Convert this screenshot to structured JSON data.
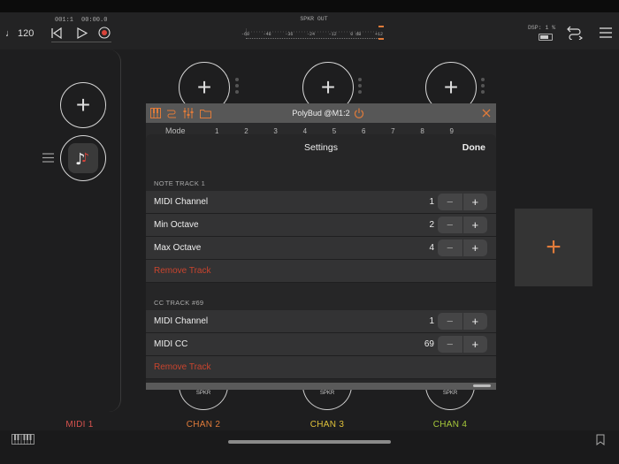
{
  "transport": {
    "bpm": "♩ 120",
    "position": "001:1",
    "time": "00:00.0"
  },
  "meter": {
    "label": "SPKR OUT",
    "ticks": [
      "-60",
      "-48",
      "-36",
      "-24",
      "-12",
      "0 dB",
      "+12"
    ]
  },
  "dsp": {
    "label": "DSP: 1 %"
  },
  "plugin": {
    "title": "PolyBud @M1:2",
    "mode_label": "Mode",
    "mode_numbers": [
      "1",
      "2",
      "3",
      "4",
      "5",
      "6",
      "7",
      "8",
      "9"
    ]
  },
  "settings": {
    "title": "Settings",
    "done": "Done",
    "sections": [
      {
        "header": "NOTE TRACK 1",
        "rows": [
          {
            "label": "MIDI Channel",
            "value": "1"
          },
          {
            "label": "Min Octave",
            "value": "2"
          },
          {
            "label": "Max Octave",
            "value": "4"
          }
        ],
        "remove": "Remove Track"
      },
      {
        "header": "CC TRACK #69",
        "rows": [
          {
            "label": "MIDI Channel",
            "value": "1"
          },
          {
            "label": "MIDI CC",
            "value": "69"
          }
        ],
        "remove": "Remove Track"
      }
    ],
    "minus": "−",
    "plus": "+"
  },
  "channels": [
    {
      "label": "MIDI 1",
      "color": "#d9534f"
    },
    {
      "label": "CHAN 2",
      "color": "#e07b3a"
    },
    {
      "label": "CHAN 3",
      "color": "#e0c23a"
    },
    {
      "label": "CHAN 4",
      "color": "#a6c83a"
    }
  ],
  "knob_label": "SPKR",
  "colors": {
    "accent": "#e07b3a",
    "danger": "#c9442e"
  }
}
